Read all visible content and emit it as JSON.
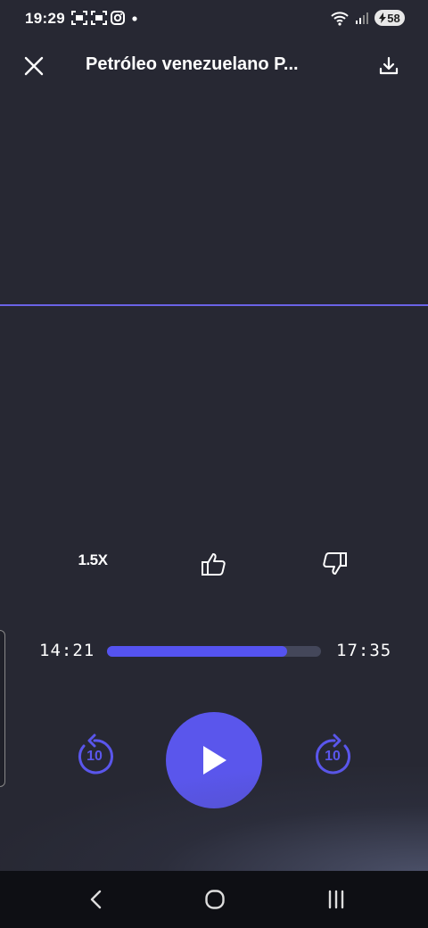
{
  "status_bar": {
    "time": "19:29",
    "battery": "58",
    "icons_left": [
      "screenshot-icon",
      "screenshot-icon",
      "instagram-icon",
      "dot-icon"
    ],
    "icons_right": [
      "wifi-icon",
      "signal-icon",
      "battery-icon"
    ]
  },
  "header": {
    "title": "Petróleo venezuelano P...",
    "close_icon": "close-icon",
    "download_icon": "download-icon"
  },
  "actions": {
    "speed_label": "1.5X",
    "like_icon": "thumbs-up-icon",
    "dislike_icon": "thumbs-down-icon"
  },
  "player": {
    "current_time": "14:21",
    "total_time": "17:35",
    "progress": 0.84,
    "rewind_label": "10",
    "forward_label": "10",
    "accent_color": "#5a56ec"
  },
  "nav": {
    "back_icon": "back-icon",
    "home_icon": "home-icon",
    "recents_icon": "recents-icon"
  }
}
